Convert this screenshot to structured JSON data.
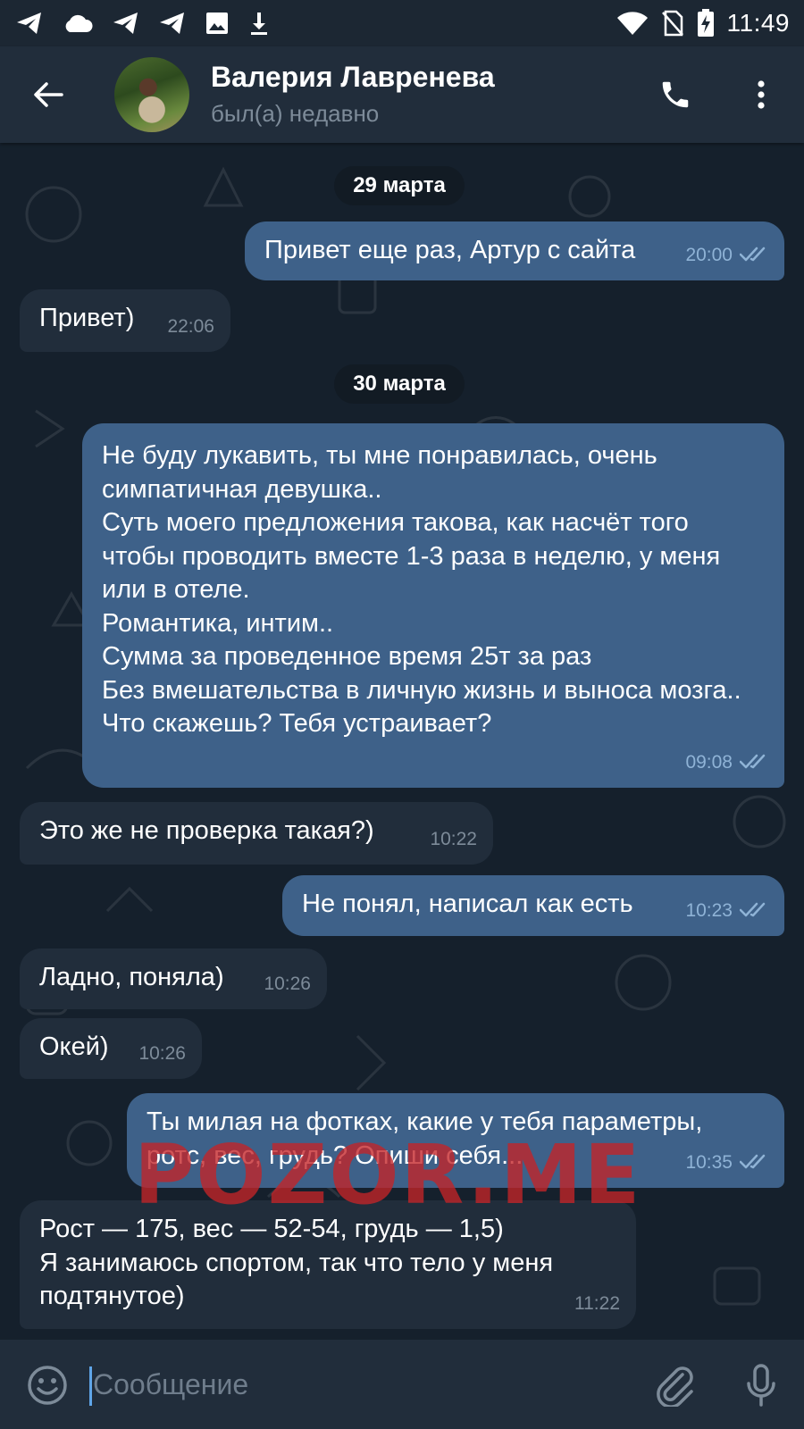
{
  "status_bar": {
    "time": "11:49"
  },
  "header": {
    "contact_name": "Валерия Лавренева",
    "contact_status": "был(а) недавно"
  },
  "dates": [
    "29 марта",
    "30 марта"
  ],
  "messages": [
    {
      "direction": "out",
      "text": "Привет еще раз, Артур с сайта",
      "time": "20:00",
      "read": true
    },
    {
      "direction": "in",
      "text": "Привет)",
      "time": "22:06"
    },
    {
      "direction": "out",
      "text": "Не буду лукавить, ты мне понравилась, очень симпатичная девушка..\nСуть моего предложения такова, как насчёт того чтобы проводить вместе 1-3 раза в неделю, у меня или в отеле.\nРомантика, интим..\nСумма за проведенное время 25т за раз\nБез вмешательства в личную жизнь и выноса мозга..\nЧто скажешь? Тебя устраивает?",
      "time": "09:08",
      "read": true
    },
    {
      "direction": "in",
      "text": "Это же не проверка такая?)",
      "time": "10:22"
    },
    {
      "direction": "out",
      "text": "Не понял, написал как есть",
      "time": "10:23",
      "read": true
    },
    {
      "direction": "in",
      "text": "Ладно, поняла)",
      "time": "10:26"
    },
    {
      "direction": "in",
      "text": "Окей)",
      "time": "10:26"
    },
    {
      "direction": "out",
      "text": "Ты милая на фотках, какие у тебя параметры, ротс, вес, грудь? Опиши себя...",
      "time": "10:35",
      "read": true
    },
    {
      "direction": "in",
      "text": "Рост — 175, вес — 52-54, грудь — 1,5)\nЯ занимаюсь спортом, так что тело у меня подтянутое)",
      "time": "11:22"
    }
  ],
  "watermark": "POZOR.ME",
  "input": {
    "placeholder": "Сообщение",
    "value": ""
  },
  "colors": {
    "background": "#15202c",
    "header": "#212d3b",
    "outgoing_bubble": "#3e6189",
    "incoming_bubble": "#212d3b",
    "read_check": "#8fb3d6",
    "caret": "#5fa5e8",
    "watermark": "#c42428"
  },
  "icons": {
    "status_left": [
      "telegram-icon",
      "cloud-icon",
      "telegram-icon",
      "telegram-icon",
      "image-icon",
      "download-icon"
    ],
    "status_right": [
      "wifi-icon",
      "no-sim-icon",
      "battery-charging-icon"
    ],
    "header": [
      "back-arrow-icon",
      "phone-icon",
      "more-vert-icon"
    ],
    "input": [
      "emoji-icon",
      "attach-icon",
      "mic-icon"
    ]
  }
}
